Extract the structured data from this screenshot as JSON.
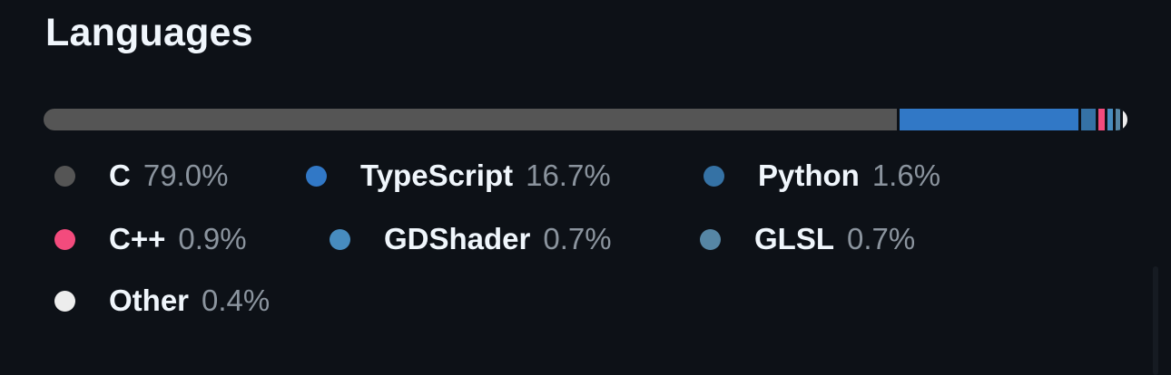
{
  "section": {
    "title": "Languages"
  },
  "languages": [
    {
      "name": "C",
      "percent": "79.0%",
      "value": 79.0,
      "color": "#555555"
    },
    {
      "name": "TypeScript",
      "percent": "16.7%",
      "value": 16.7,
      "color": "#3178c6"
    },
    {
      "name": "Python",
      "percent": "1.6%",
      "value": 1.6,
      "color": "#3572a5"
    },
    {
      "name": "C++",
      "percent": "0.9%",
      "value": 0.9,
      "color": "#f34b7d"
    },
    {
      "name": "GDShader",
      "percent": "0.7%",
      "value": 0.7,
      "color": "#478cbf"
    },
    {
      "name": "GLSL",
      "percent": "0.7%",
      "value": 0.7,
      "color": "#5686a5"
    },
    {
      "name": "Other",
      "percent": "0.4%",
      "value": 0.4,
      "color": "#ededed"
    }
  ]
}
